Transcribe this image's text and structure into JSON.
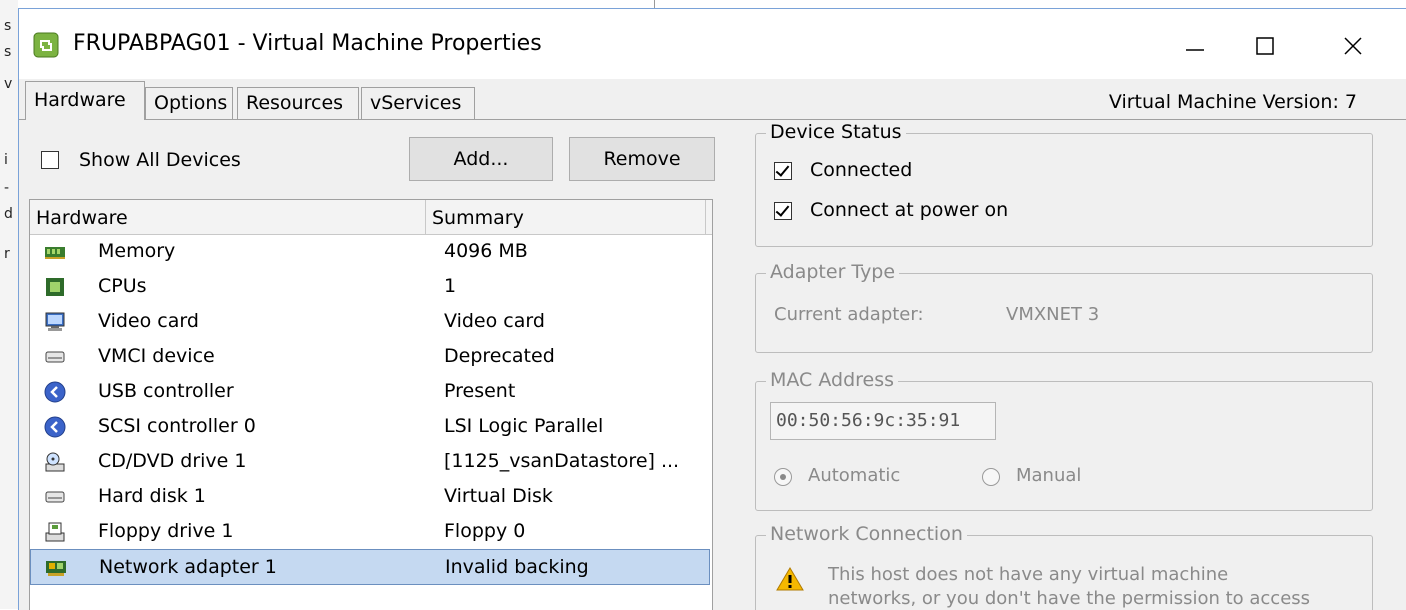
{
  "background_strip": {
    "glyphs": [
      "s",
      "s",
      "v",
      "i",
      "-",
      "d",
      "r"
    ]
  },
  "window": {
    "title": "FRUPABPAG01 - Virtual Machine Properties",
    "controls": {
      "minimize": "—",
      "maximize": "☐",
      "close": "✕"
    }
  },
  "tabs": [
    {
      "label": "Hardware",
      "active": true
    },
    {
      "label": "Options",
      "active": false
    },
    {
      "label": "Resources",
      "active": false
    },
    {
      "label": "vServices",
      "active": false
    }
  ],
  "version_label": "Virtual Machine Version: 7",
  "hardware_panel": {
    "show_all_devices_label": "Show All Devices",
    "show_all_devices_checked": false,
    "add_button": "Add...",
    "remove_button": "Remove",
    "columns": {
      "hardware": "Hardware",
      "summary": "Summary"
    },
    "rows": [
      {
        "name": "Memory",
        "summary": "4096 MB",
        "icon": "memory-icon"
      },
      {
        "name": "CPUs",
        "summary": "1",
        "icon": "cpu-icon"
      },
      {
        "name": "Video card",
        "summary": "Video card",
        "icon": "video-card-icon"
      },
      {
        "name": "VMCI device",
        "summary": "Deprecated",
        "icon": "vmci-device-icon"
      },
      {
        "name": "USB controller",
        "summary": "Present",
        "icon": "usb-controller-icon"
      },
      {
        "name": "SCSI controller 0",
        "summary": "LSI Logic Parallel",
        "icon": "scsi-controller-icon"
      },
      {
        "name": "CD/DVD drive 1",
        "summary": "[1125_vsanDatastore] ...",
        "icon": "cd-dvd-icon"
      },
      {
        "name": "Hard disk 1",
        "summary": "Virtual Disk",
        "icon": "hard-disk-icon"
      },
      {
        "name": "Floppy drive 1",
        "summary": "Floppy 0",
        "icon": "floppy-icon"
      },
      {
        "name": "Network adapter 1",
        "summary": "Invalid backing",
        "icon": "network-adapter-icon",
        "selected": true
      }
    ]
  },
  "device_status": {
    "legend": "Device Status",
    "connected_label": "Connected",
    "connected_checked": true,
    "connect_power_label": "Connect at power on",
    "connect_power_checked": true
  },
  "adapter_type": {
    "legend": "Adapter Type",
    "current_label": "Current adapter:",
    "current_value": "VMXNET 3"
  },
  "mac_address": {
    "legend": "MAC Address",
    "value": "00:50:56:9c:35:91",
    "automatic_label": "Automatic",
    "manual_label": "Manual",
    "selected": "Automatic"
  },
  "network_connection": {
    "legend": "Network Connection",
    "warning_line1": "This host does not have any virtual machine",
    "warning_line2": "networks, or you don't have the permission to access"
  },
  "colors": {
    "selection_bg": "#c5d9f1",
    "window_bg": "#f0f0f0",
    "warning": "#f5b800"
  }
}
